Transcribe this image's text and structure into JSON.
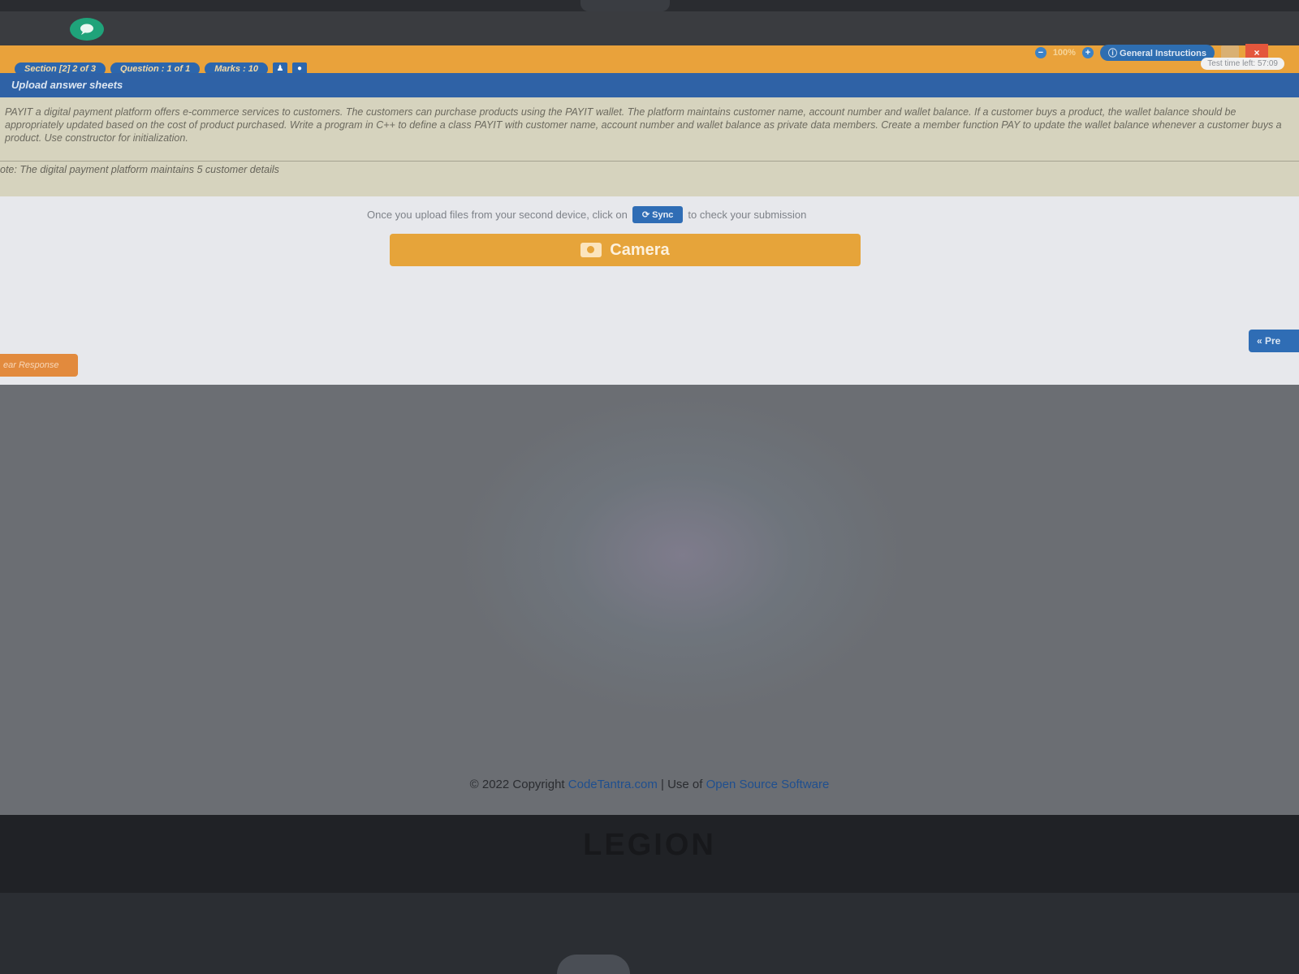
{
  "topbar": {
    "brand_left": "",
    "brand_right": "",
    "zoom": "100%",
    "general_instructions": "General Instructions",
    "close": "×",
    "timer": "Test time left: 57:09"
  },
  "pills": {
    "section": "Section [2] 2 of 3",
    "question": "Question : 1 of 1",
    "marks": "Marks : 10"
  },
  "upload_title": "Upload answer sheets",
  "question": {
    "text": "PAYIT a digital payment platform offers e-commerce services to customers. The customers can purchase products using the PAYIT wallet. The platform maintains customer name, account number and wallet balance. If a customer buys a product, the wallet balance should be appropriately updated based on the cost of product purchased. Write a program in C++ to define a class PAYIT with customer name, account number and wallet balance as private data members. Create a member function PAY to update the wallet balance whenever a customer buys a product. Use constructor for initialization.",
    "note": "ote: The digital payment platform maintains 5 customer details"
  },
  "upload": {
    "prefix": "Once you upload files from your second device, click on",
    "sync": "Sync",
    "suffix": "to check your submission",
    "camera": "Camera"
  },
  "buttons": {
    "clear_response": "ear Response",
    "previous": "« Pre"
  },
  "footer": {
    "copyright": "© 2022 Copyright",
    "site": "CodeTantra.com",
    "sep": "| Use of",
    "oss": "Open Source Software"
  },
  "device_brand": "LEGION",
  "colors": {
    "orange": "#e9a23b",
    "blue": "#2f62a6",
    "close_red": "#e4563c",
    "logo_green": "#1fa37a"
  }
}
